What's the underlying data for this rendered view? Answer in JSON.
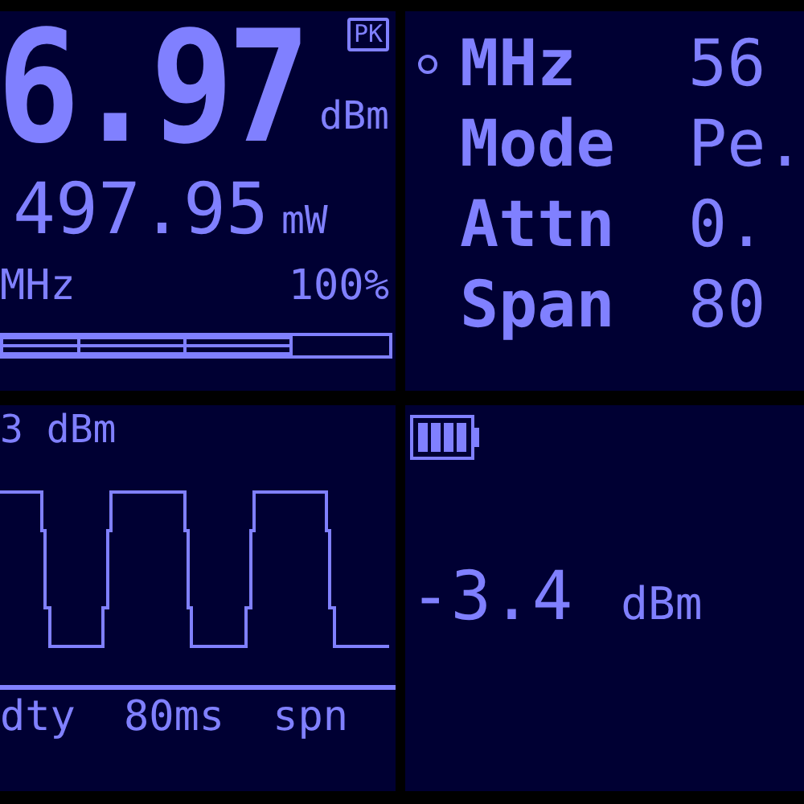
{
  "reading": {
    "value": "6.97",
    "badge": "PK",
    "unit": "dBm",
    "power": "497.95",
    "power_unit": "mW",
    "frequency_unit": "MHz",
    "percent": "100%",
    "level": 0.75
  },
  "settings": [
    {
      "label": "MHz",
      "value": "56",
      "selected": true
    },
    {
      "label": "Mode",
      "value": "Pe.",
      "selected": false
    },
    {
      "label": "Attn",
      "value": "0.",
      "selected": false
    },
    {
      "label": "Span",
      "value": "80",
      "selected": false
    }
  ],
  "trace": {
    "value": "3 dBm",
    "footer": [
      "dty",
      "80ms",
      "spn"
    ]
  },
  "secondary": {
    "value": "-3.4",
    "unit": "dBm"
  }
}
